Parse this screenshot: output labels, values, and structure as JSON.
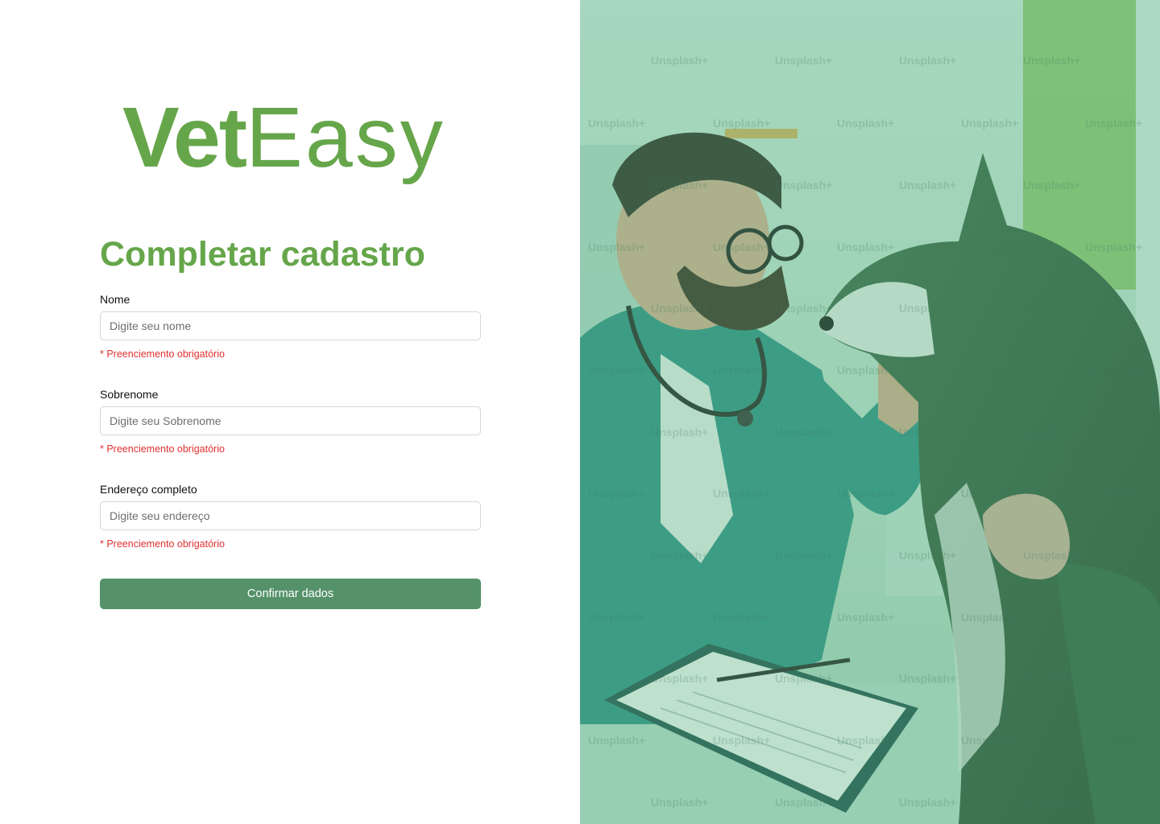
{
  "brand": {
    "name_bold": "Vet",
    "name_light": "Easy"
  },
  "form": {
    "title": "Completar cadastro",
    "fields": [
      {
        "label": "Nome",
        "placeholder": "Digite seu nome",
        "error": "* Preenciemento obrigatório"
      },
      {
        "label": "Sobrenome",
        "placeholder": "Digite seu Sobrenome",
        "error": "* Preenciemento obrigatório"
      },
      {
        "label": "Endereço completo",
        "placeholder": "Digite seu endereço",
        "error": "* Preenciemento obrigatório"
      }
    ],
    "submit_label": "Confirmar dados"
  },
  "hero_image": {
    "watermark": "Unsplash+",
    "overlay_color": "#5cb884"
  },
  "colors": {
    "brand_green": "#66a64a",
    "button_green": "#55926a",
    "error_red": "#e03030"
  }
}
